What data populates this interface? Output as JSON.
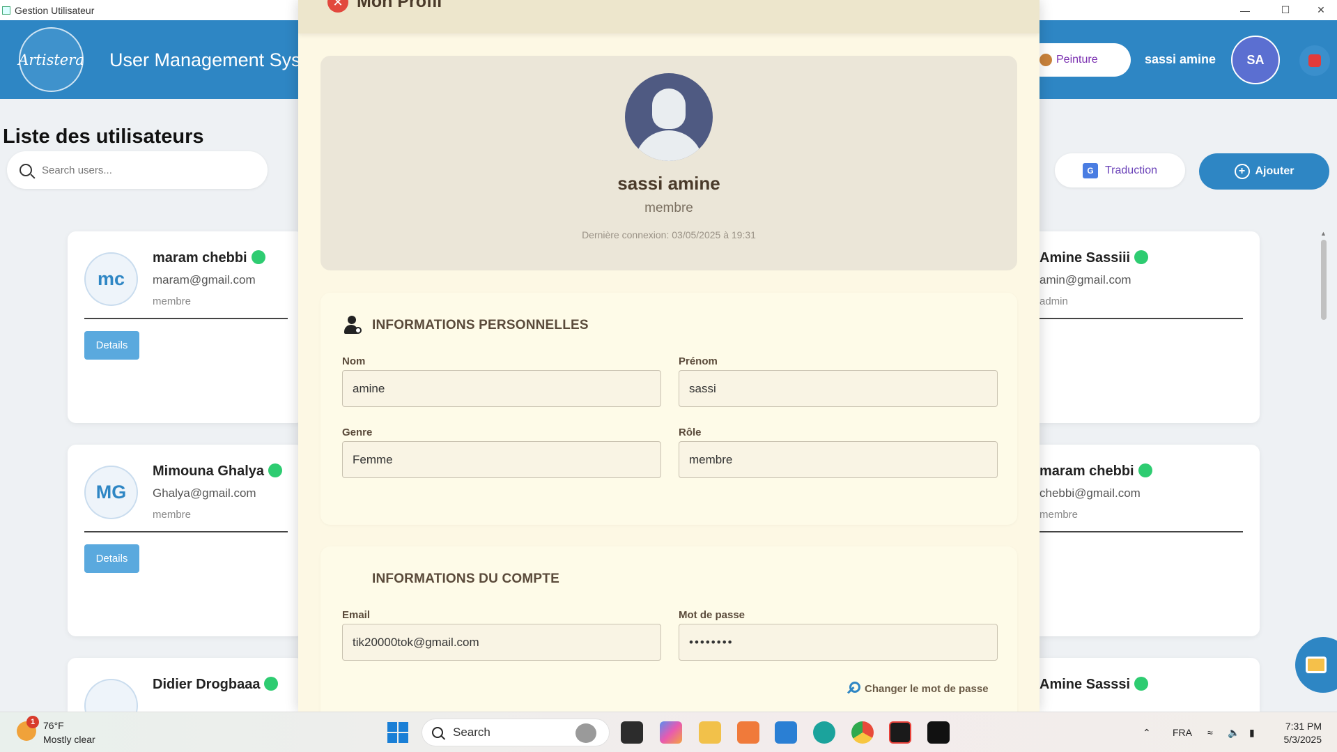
{
  "window": {
    "title": "Gestion Utilisateur"
  },
  "header": {
    "logo_text": "Artistera",
    "title": "User Management Sys",
    "peinture_label": "Peinture",
    "user_name": "sassi amine",
    "avatar_initials": "SA"
  },
  "list": {
    "title": "Liste des utilisateurs",
    "search_placeholder": "Search users...",
    "traduction_label": "Traduction",
    "ajouter_label": "Ajouter",
    "details_label": "Details",
    "left_cards": [
      {
        "initials": "mc",
        "name": "maram chebbi",
        "email": "maram@gmail.com",
        "role": "membre"
      },
      {
        "initials": "MG",
        "name": "Mimouna Ghalya",
        "email": "Ghalya@gmail.com",
        "role": "membre"
      },
      {
        "initials": "",
        "name": "Didier Drogbaaa",
        "email": "",
        "role": ""
      }
    ],
    "right_cards": [
      {
        "name": "Amine Sassiii",
        "email": "amin@gmail.com",
        "role": "admin"
      },
      {
        "name": "maram chebbi",
        "email": "chebbi@gmail.com",
        "role": "membre"
      },
      {
        "name": "Amine Sasssi",
        "email": "",
        "role": ""
      }
    ]
  },
  "modal": {
    "title": "Mon Profil",
    "profile": {
      "name": "sassi amine",
      "role": "membre",
      "last_login": "Dernière connexion: 03/05/2025 à 19:31"
    },
    "personal": {
      "title": "INFORMATIONS PERSONNELLES",
      "nom_label": "Nom",
      "nom_value": "amine",
      "prenom_label": "Prénom",
      "prenom_value": "sassi",
      "genre_label": "Genre",
      "genre_value": "Femme",
      "role_label": "Rôle",
      "role_value": "membre"
    },
    "account": {
      "title": "INFORMATIONS DU COMPTE",
      "email_label": "Email",
      "email_value": "tik20000tok@gmail.com",
      "password_label": "Mot de passe",
      "password_value": "••••••••",
      "change_password_label": "Changer le mot de passe"
    }
  },
  "taskbar": {
    "weather_temp": "76°F",
    "weather_desc": "Mostly clear",
    "weather_badge": "1",
    "search_label": "Search",
    "language": "FRA",
    "time": "7:31 PM",
    "date": "5/3/2025"
  },
  "colors": {
    "header_blue": "#2e86c4",
    "modal_bg": "#fdf8e4",
    "online_green": "#2ecc71",
    "details_button": "#5aa9de"
  }
}
